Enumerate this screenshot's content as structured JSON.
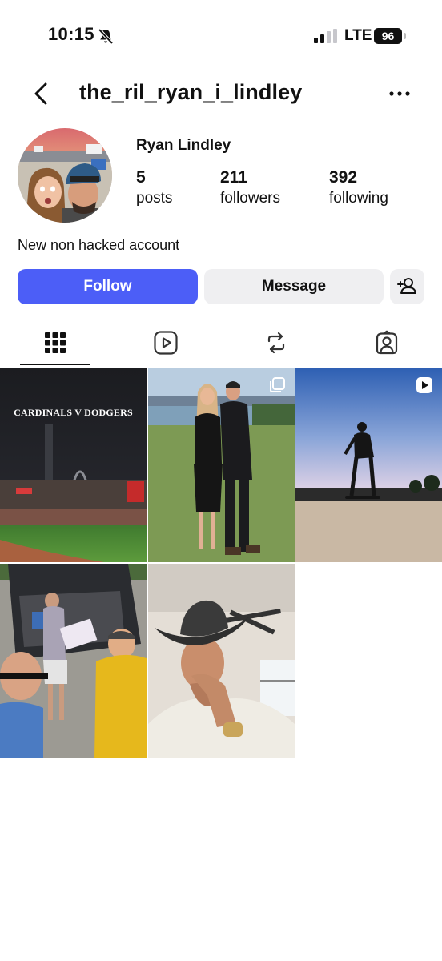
{
  "status_bar": {
    "time": "10:15",
    "network": "LTE",
    "battery": "96",
    "icons": [
      "bell-slash-icon",
      "signal-icon",
      "battery-icon"
    ]
  },
  "header": {
    "username": "the_ril_ryan_i_lindley",
    "icons": [
      "back-icon",
      "more-icon"
    ]
  },
  "profile": {
    "display_name": "Ryan Lindley",
    "stats": [
      {
        "value": "5",
        "label": "posts"
      },
      {
        "value": "211",
        "label": "followers"
      },
      {
        "value": "392",
        "label": "following"
      }
    ],
    "bio": "New non hacked account"
  },
  "actions": {
    "follow": "Follow",
    "message": "Message",
    "add_user_icon": "add-user-icon"
  },
  "colors": {
    "follow_button": "#4c5ef7",
    "secondary_button": "#efeff1",
    "text": "#111111"
  },
  "tabs": [
    "grid-icon",
    "reels-icon",
    "reposts-icon",
    "tagged-icon"
  ],
  "posts": [
    {
      "caption": "CARDINALS V DODGERS",
      "type": "photo"
    },
    {
      "caption": "",
      "type": "carousel"
    },
    {
      "caption": "",
      "type": "reel"
    },
    {
      "caption": "",
      "type": "photo"
    },
    {
      "caption": "",
      "type": "photo"
    }
  ]
}
